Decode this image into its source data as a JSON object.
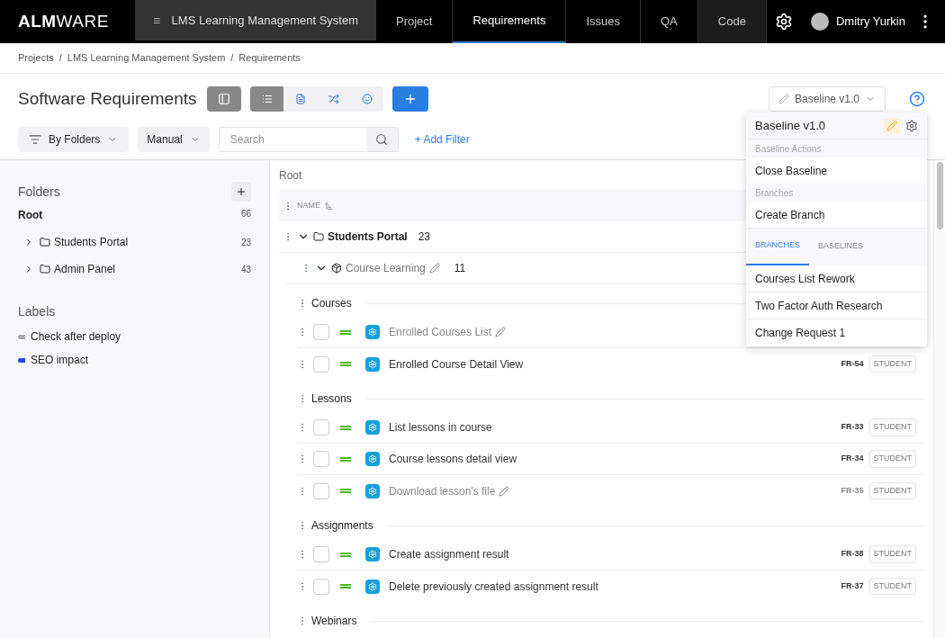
{
  "brand": {
    "bold": "ALM",
    "light": "WARE"
  },
  "nav": {
    "project": "LMS Learning Management System",
    "tabs": [
      {
        "label": "Project",
        "selected": false,
        "hovered": false
      },
      {
        "label": "Requirements",
        "selected": true,
        "hovered": false
      },
      {
        "label": "Issues",
        "selected": false,
        "hovered": false
      },
      {
        "label": "QA",
        "selected": false,
        "hovered": false
      },
      {
        "label": "Code",
        "selected": false,
        "hovered": true
      }
    ],
    "user": "Dmitry Yurkin"
  },
  "breadcrumbs": {
    "separator": "/",
    "items": [
      "Projects",
      "LMS Learning Management System",
      "Requirements"
    ]
  },
  "page_title": "Software Requirements",
  "sidebar_toggle": {
    "on": true
  },
  "view_modes": [
    {
      "kind": "list",
      "selected": true
    },
    {
      "kind": "document",
      "selected": false
    },
    {
      "kind": "shuffle",
      "selected": false
    },
    {
      "kind": "persona",
      "selected": false
    }
  ],
  "filters": {
    "group_by": "By Folders",
    "order": "Manual",
    "search": {
      "placeholder": "Search"
    },
    "add_filter": "+ Add Filter"
  },
  "baseline_button": "Baseline v1.0",
  "sidebar": {
    "folders_title": "Folders",
    "root": {
      "label": "Root",
      "count": "66"
    },
    "folders": [
      {
        "label": "Students Portal",
        "count": "23",
        "expanded": false
      },
      {
        "label": "Admin Panel",
        "count": "43",
        "expanded": false
      }
    ],
    "labels_title": "Labels",
    "labels": [
      {
        "label": "Check after deploy",
        "color": "#a8a8a8"
      },
      {
        "label": "SEO impact",
        "color": "#2244ee"
      }
    ]
  },
  "table": {
    "path": "Root",
    "column": "NAME",
    "folder": {
      "label": "Students Portal",
      "count": "23",
      "expanded": true
    },
    "module": {
      "label": "Course Learning",
      "count": "11",
      "expanded": true
    },
    "groups": [
      {
        "label": "Courses",
        "items": [
          {
            "title": "Enrolled Courses List",
            "editing": true,
            "checked": false
          },
          {
            "title": "Enrolled Course Detail View",
            "editing": false,
            "checked": false,
            "id": "FR-54",
            "tag": "STUDENT"
          }
        ]
      },
      {
        "label": "Lessons",
        "items": [
          {
            "title": "List lessons in course",
            "editing": false,
            "checked": false,
            "id": "FR-33",
            "tag": "STUDENT"
          },
          {
            "title": "Course lessons detail view",
            "editing": false,
            "checked": false,
            "id": "FR-34",
            "tag": "STUDENT"
          },
          {
            "title": "Download lesson's file",
            "editing": true,
            "checked": false,
            "id": "FR-35",
            "tag": "STUDENT"
          }
        ]
      },
      {
        "label": "Assignments",
        "items": [
          {
            "title": "Create assignment result",
            "editing": false,
            "checked": false,
            "id": "FR-38",
            "tag": "STUDENT"
          },
          {
            "title": "Delete previously created assignment result",
            "editing": false,
            "checked": false,
            "id": "FR-37",
            "tag": "STUDENT"
          }
        ]
      },
      {
        "label": "Webinars"
      }
    ]
  },
  "dropdown": {
    "title": "Baseline v1.0",
    "sections": [
      {
        "heading": "Baseline Actions",
        "action": "Close Baseline"
      },
      {
        "heading": "Branches",
        "action": "Create Branch"
      }
    ],
    "tabs": [
      {
        "label": "BRANCHES",
        "selected": true
      },
      {
        "label": "BASELINES",
        "selected": false
      }
    ],
    "items": [
      "Courses List Rework",
      "Two Factor Auth Research",
      "Change Request 1"
    ]
  }
}
